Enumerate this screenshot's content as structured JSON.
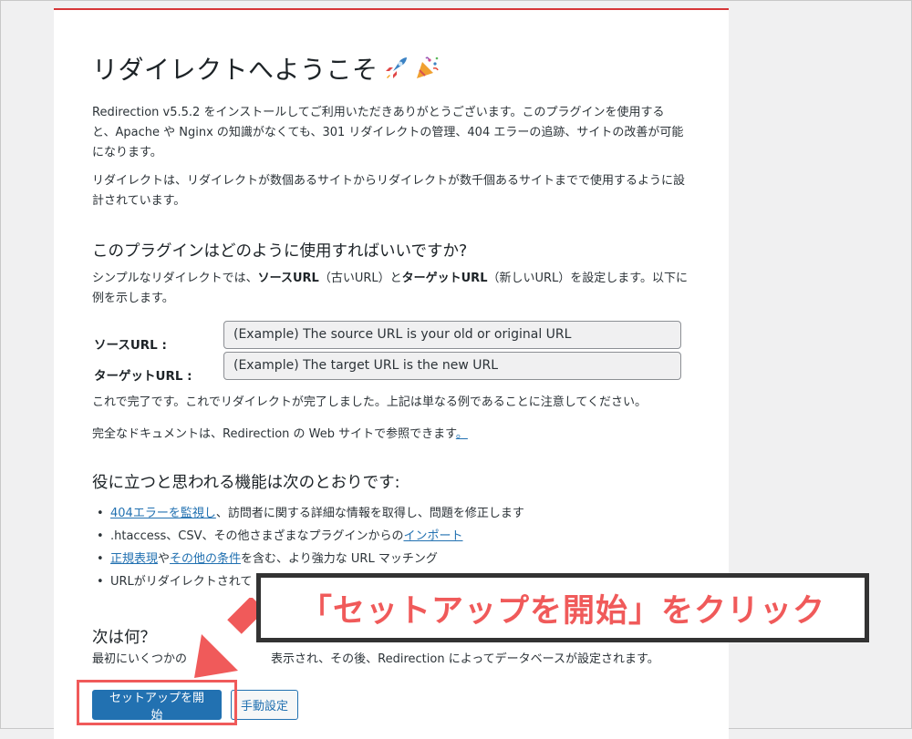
{
  "title": "リダイレクトへようこそ",
  "title_emoji": [
    "rocket-icon",
    "party-popper-icon"
  ],
  "intro": "Redirection v5.5.2 をインストールしてご利用いただきありがとうございます。このプラグインを使用すると、Apache や Nginx の知識がなくても、301 リダイレクトの管理、404 エラーの追跡、サイトの改善が可能になります。",
  "scale_note": "リダイレクトは、リダイレクトが数個あるサイトからリダイレクトが数千個あるサイトまでで使用するように設計されています。",
  "how_heading": "このプラグインはどのように使用すればいいですか?",
  "simple_redirect": {
    "prefix": "シンプルなリダイレクトでは、",
    "source_term": "ソースURL",
    "source_paren": "（古いURL）と",
    "target_term": "ターゲットURL",
    "suffix": "（新しいURL）を設定します。以下に例を示します。"
  },
  "example": {
    "source_label": "ソースURL :",
    "source_value": "(Example) The source URL is your old or original URL",
    "target_label": "ターゲットURL :",
    "target_value": "(Example) The target URL is the new URL"
  },
  "done_text": "これで完了です。これでリダイレクトが完了しました。上記は単なる例であることに注意してください。",
  "docs_text": "完全なドキュメントは、Redirection の Web サイトで参照できます",
  "docs_link": "。",
  "features_heading": "役に立つと思われる機能は次のとおりです:",
  "features": {
    "f1_link": "404エラーを監視し",
    "f1_text": "、訪問者に関する詳細な情報を取得し、問題を修正します",
    "f2_text": ".htaccess、CSV、その他さまざまなプラグインからの",
    "f2_link": "インポート",
    "f3_link_a": "正規表現",
    "f3_mid": "や",
    "f3_link_b": "その他の条件",
    "f3_text": "を含む、より強力な URL マッチング",
    "f4_text": "URLがリダイレクトされて"
  },
  "next_heading": "次は何？",
  "next_text_a": "最初にいくつかの",
  "next_text_b": "表示され、その後、Redirection によってデータベースが設定されます。",
  "buttons": {
    "start_setup": "セットアップを開始",
    "manual_setup": "手動設定"
  },
  "annotation": {
    "callout": "「セットアップを開始」をクリック",
    "accent_color": "#f05a5a"
  }
}
